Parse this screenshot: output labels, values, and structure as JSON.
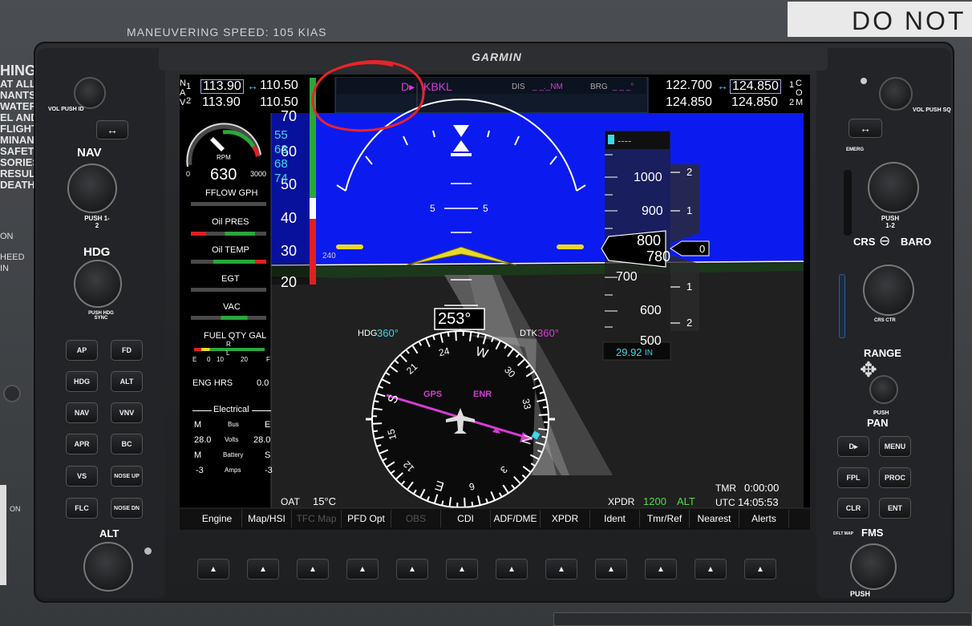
{
  "panel": {
    "maneuvering_speed": "MANEUVERING SPEED:  105 KIAS",
    "do_not": "DO  NOT",
    "warning_lines": [
      "HING",
      "AT ALL",
      "NANTS",
      "WATER",
      "EL AND",
      "FLIGHT",
      "MINANT",
      "SAFETY",
      "SORIES",
      "RESULT",
      "DEATH."
    ],
    "left_edge": {
      "on": "ON",
      "heed": "HEED",
      "in": "IN",
      "on2": "ON"
    },
    "brand": "GARMIN"
  },
  "left_bezel": {
    "vol_push_id": "VOL PUSH ID",
    "nav": "NAV",
    "push_1_2": "PUSH 1-2",
    "hdg": "HDG",
    "push_hdg_sync": "PUSH HDG SYNC",
    "alt": "ALT",
    "buttons": [
      [
        "AP",
        "FD"
      ],
      [
        "HDG",
        "ALT"
      ],
      [
        "NAV",
        "VNV"
      ],
      [
        "APR",
        "BC"
      ],
      [
        "VS",
        "NOSE UP"
      ],
      [
        "FLC",
        "NOSE DN"
      ]
    ]
  },
  "right_bezel": {
    "vol_push_sq": "VOL PUSH SQ",
    "emerg": "EMERG",
    "push_1_2": "PUSH 1-2",
    "crs_baro": "CRS",
    "baro": "BARO",
    "crs_ctr": "CRS CTR",
    "range": "RANGE",
    "push": "PUSH",
    "pan": "PAN",
    "menu": "MENU",
    "direct": "D▸",
    "fpl": "FPL",
    "proc": "PROC",
    "clr": "CLR",
    "ent": "ENT",
    "dflt_map": "DFLT MAP",
    "fms": "FMS",
    "push_crsr": "PUSH"
  },
  "nav_radio": {
    "nav1_active": "113.90",
    "nav1_standby": "110.50",
    "nav2_active": "113.90",
    "nav2_standby": "110.50",
    "label_n": "N",
    "label_a": "A",
    "label_v": "V",
    "idx1": "1",
    "idx2": "2"
  },
  "com_radio": {
    "com1_active": "122.700",
    "com1_standby": "124.850",
    "com2_active": "124.850",
    "com2_standby": "124.850",
    "label_c": "C",
    "label_o": "O",
    "label_m": "M",
    "idx1": "1",
    "idx2": "2"
  },
  "nav_status": {
    "waypoint": "KBKL",
    "dis_label": "DIS",
    "dis_value": "_ _._NM",
    "brg_label": "BRG",
    "brg_value": "_ _ _°"
  },
  "engine": {
    "rpm_label": "RPM",
    "rpm_value": "630",
    "rpm_min": "0",
    "rpm_max": "3000",
    "fflow": "FFLOW GPH",
    "oil_pres": "Oil PRES",
    "oil_temp": "Oil TEMP",
    "egt": "EGT",
    "vac": "VAC",
    "fuel_qty": "FUEL QTY GAL",
    "fuel_e": "E",
    "fuel_0": "0",
    "fuel_10": "10",
    "fuel_20": "20",
    "fuel_f": "F",
    "fuel_marker": "R",
    "fuel_marker_l": "L",
    "eng_hrs_label": "ENG HRS",
    "eng_hrs_value": "0.0",
    "electrical": "Electrical",
    "m1": "M",
    "bus": "Bus",
    "e": "E",
    "v1": "28.0",
    "volts": "Volts",
    "v2": "28.0",
    "m2": "M",
    "battery": "Battery",
    "s": "S",
    "a1": "-3",
    "amps": "Amps",
    "a2": "-3"
  },
  "airspeed": {
    "ticks": [
      "70",
      "60",
      "50",
      "40",
      "30",
      "20"
    ],
    "vspeeds": [
      "55",
      "63",
      "68",
      "74"
    ],
    "tas": "240"
  },
  "attitude": {
    "pitch_left": "5",
    "pitch_right": "5"
  },
  "altimeter": {
    "selected": "----",
    "ticks": [
      "1000",
      "900",
      "700",
      "600",
      "500"
    ],
    "current_hundreds": "800",
    "current_tens": "780",
    "vsi_ticks": [
      "2",
      "1",
      "1",
      "2"
    ],
    "vsi_value": "0",
    "baro": "29.92",
    "baro_unit": "IN"
  },
  "hsi": {
    "heading": "253°",
    "hdg_label": "HDG",
    "hdg_value": "360°",
    "dtk_label": "DTK",
    "dtk_value": "360°",
    "gps": "GPS",
    "enr": "ENR",
    "card": [
      "24",
      "W",
      "30",
      "33",
      "N",
      "3",
      "6",
      "E",
      "12",
      "15",
      "S",
      "21"
    ]
  },
  "footer": {
    "oat_label": "OAT",
    "oat_value": "15°C",
    "xpdr_label": "XPDR",
    "xpdr_code": "1200",
    "xpdr_mode": "ALT",
    "tmr_label": "TMR",
    "tmr_value": "0:00:00",
    "utc_label": "UTC",
    "utc_value": "14:05:53"
  },
  "softkeys": [
    "Engine",
    "Map/HSI",
    "TFC Map",
    "PFD Opt",
    "OBS",
    "CDI",
    "ADF/DME",
    "XPDR",
    "Ident",
    "Tmr/Ref",
    "Nearest",
    "Alerts"
  ]
}
